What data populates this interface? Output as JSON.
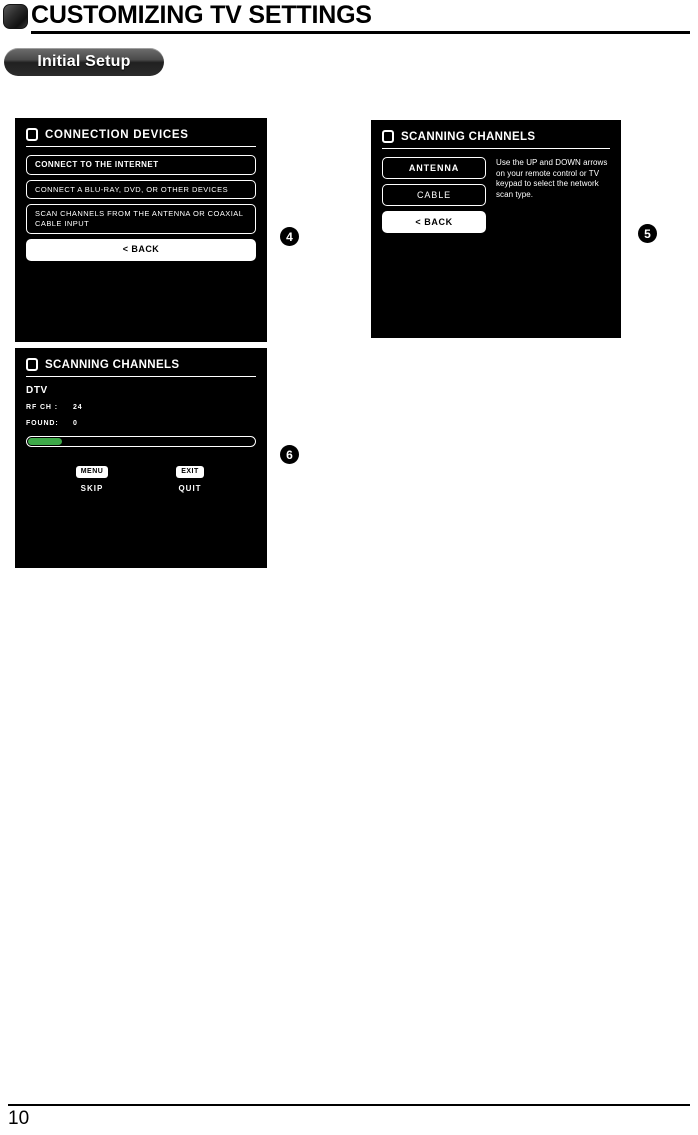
{
  "header": {
    "icon": "rounded-square-icon",
    "title": "CUSTOMIZING TV SETTINGS"
  },
  "section_pill": {
    "label": "Initial Setup"
  },
  "colors": {
    "panel_background": "#000000",
    "panel_text": "#ffffff",
    "progress_fill": "#3da848",
    "page_background": "#ffffff"
  },
  "panels": [
    {
      "step": "4",
      "icon": "screen-box-icon",
      "title": "CONNECTION DEVICES",
      "items": [
        {
          "label": "CONNECT TO THE INTERNET",
          "style": "bold"
        },
        {
          "label": "CONNECT A BLU-RAY, DVD, OR OTHER DEVICES",
          "style": "normal"
        },
        {
          "label": "SCAN CHANNELS FROM THE ANTENNA OR COAXIAL CABLE INPUT",
          "style": "normal"
        },
        {
          "label": "< BACK",
          "style": "selected"
        }
      ]
    },
    {
      "step": "5",
      "icon": "screen-box-icon",
      "title": "SCANNING CHANNELS",
      "options": [
        {
          "label": "ANTENNA",
          "style": "bold"
        },
        {
          "label": "CABLE",
          "style": "normal"
        },
        {
          "label": "< BACK",
          "style": "selected"
        }
      ],
      "help_text": "Use the UP and DOWN arrows on your remote control or TV keypad to select the network scan type."
    },
    {
      "step": "6",
      "icon": "screen-box-icon",
      "title": "SCANNING CHANNELS",
      "scan_mode": "DTV",
      "status_rows": [
        {
          "key": "RF CH :",
          "value": "24"
        },
        {
          "key": "FOUND:",
          "value": "0"
        }
      ],
      "progress_percent": 16,
      "keys": [
        {
          "cap": "MENU",
          "action": "SKIP"
        },
        {
          "cap": "EXIT",
          "action": "QUIT"
        }
      ]
    }
  ],
  "footer": {
    "page_number": "10"
  }
}
